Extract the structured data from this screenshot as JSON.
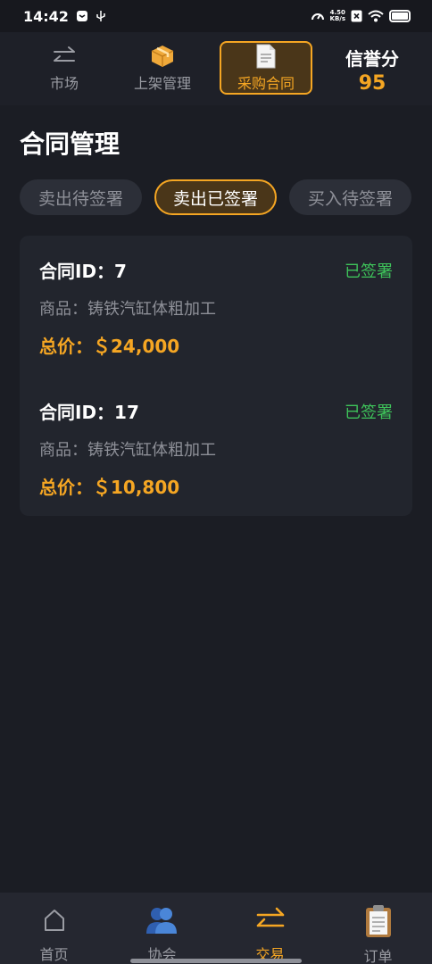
{
  "status_bar": {
    "time": "14:42",
    "speed_value": "4.50",
    "speed_unit": "KB/s",
    "icons": [
      "message-icon",
      "usb-icon",
      "speedometer-icon",
      "close-box-icon",
      "wifi-icon",
      "battery-icon"
    ]
  },
  "top_nav": {
    "tabs": [
      {
        "label": "市场",
        "icon": "swap-arrows-icon",
        "active": false
      },
      {
        "label": "上架管理",
        "icon": "package-icon",
        "active": false
      },
      {
        "label": "采购合同",
        "icon": "document-icon",
        "active": true
      }
    ],
    "credit_label": "信誉分",
    "credit_value": "95"
  },
  "page": {
    "title": "合同管理"
  },
  "filters": [
    {
      "label": "卖出待签署",
      "active": false
    },
    {
      "label": "卖出已签署",
      "active": true
    },
    {
      "label": "买入待签署",
      "active": false
    }
  ],
  "contracts": [
    {
      "id_label": "合同ID：7",
      "status": "已签署",
      "goods": "商品：铸铁汽缸体粗加工",
      "price": "总价：＄24,000"
    },
    {
      "id_label": "合同ID：17",
      "status": "已签署",
      "goods": "商品：铸铁汽缸体粗加工",
      "price": "总价：＄10,800"
    }
  ],
  "bottom_nav": [
    {
      "label": "首页",
      "icon": "home-icon",
      "active": false
    },
    {
      "label": "协会",
      "icon": "people-icon",
      "active": false
    },
    {
      "label": "交易",
      "icon": "swap-arrows-icon",
      "active": true
    },
    {
      "label": "订单",
      "icon": "clipboard-icon",
      "active": false
    }
  ],
  "colors": {
    "accent": "#f5a623",
    "signed": "#3ec35a",
    "background": "#1b1d24",
    "card": "#22252d"
  }
}
